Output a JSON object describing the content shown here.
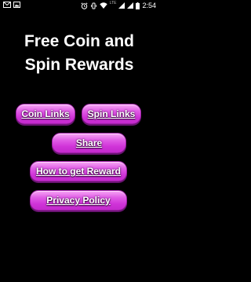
{
  "status_bar": {
    "time": "2:54",
    "network_label": "LTE",
    "left_icons": [
      "mail-icon",
      "image-icon"
    ],
    "right_icons": [
      "alarm-icon",
      "vibrate-icon",
      "wifi-icon",
      "cell-signal-icon",
      "cell-signal-icon",
      "battery-icon"
    ]
  },
  "header": {
    "title_line1": "Free Coin and",
    "title_line2": "Spin Rewards"
  },
  "buttons": {
    "coin_links": "Coin Links",
    "spin_links": "Spin Links",
    "share": "Share",
    "how_to": "How to get Reward",
    "privacy": "Privacy Policy"
  },
  "colors": {
    "background": "#000000",
    "button_fill": "#d93ee0",
    "button_highlight": "#f7a8f5",
    "button_text": "#ffffff"
  }
}
